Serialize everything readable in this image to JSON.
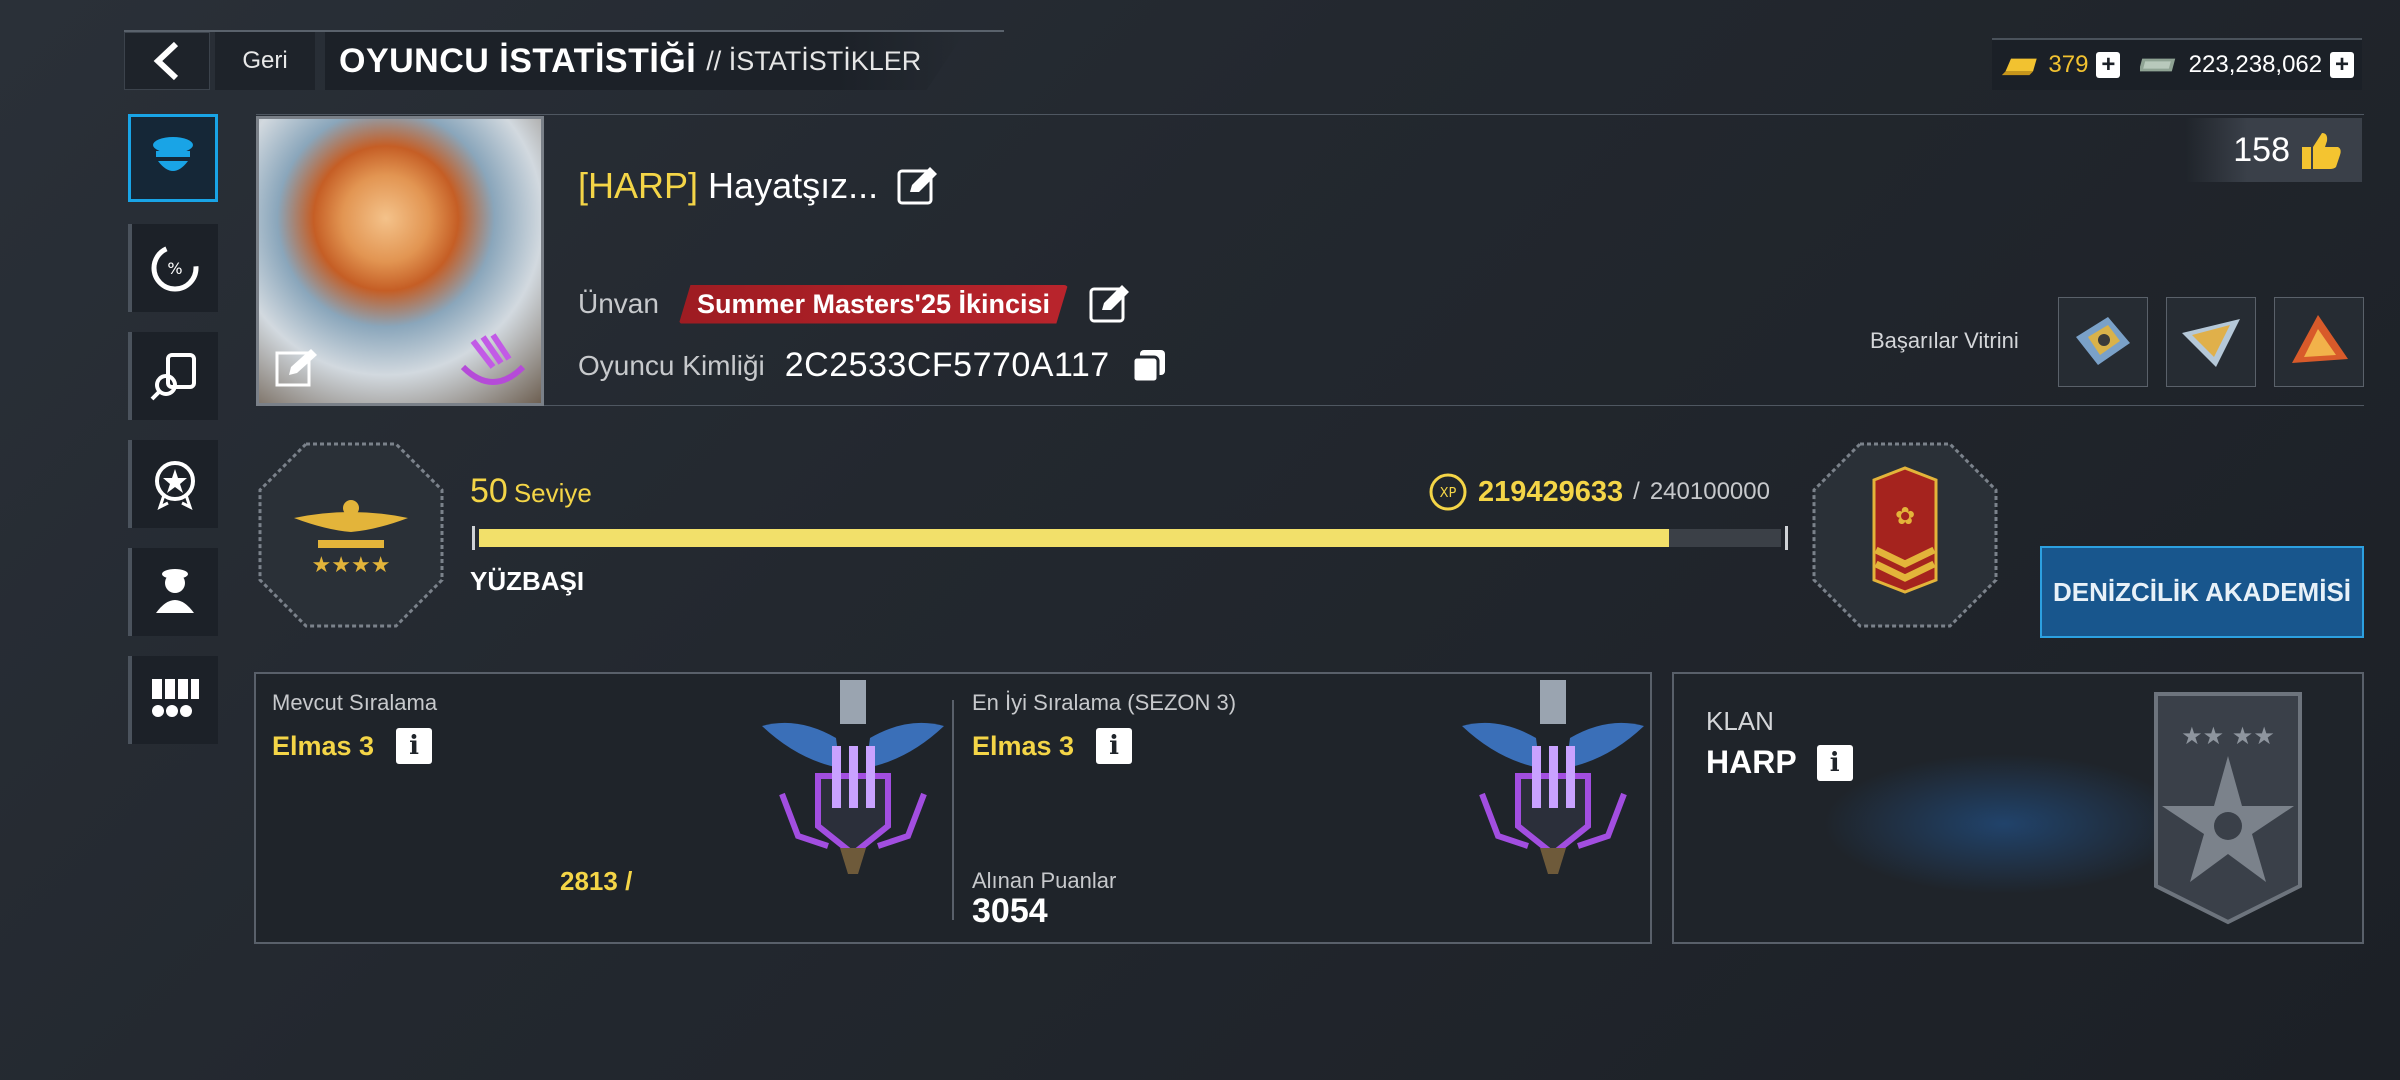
{
  "header": {
    "back_label": "Geri",
    "title": "OYUNCU İSTATİSTİĞİ",
    "subtitle": "// İSTATİSTİKLER"
  },
  "currency": {
    "gold": "379",
    "cash": "223,238,062",
    "gold_color": "#f2c230",
    "cash_color": "#9fb3a4"
  },
  "nav": {
    "items": [
      "profile-icon",
      "stats-icon",
      "search-report-icon",
      "medal-icon",
      "crew-icon",
      "ribbons-icon"
    ],
    "active": 0
  },
  "profile": {
    "clan_tag": "[HARP]",
    "name": "Hayatşız...",
    "title_label": "Ünvan",
    "title_value": "Summer Masters'25 İkincisi",
    "id_label": "Oyuncu Kimliği",
    "id_value": "2C2533CF5770A117",
    "likes": "158",
    "showcase_label": "Başarılar Vitrini"
  },
  "level": {
    "value": "50",
    "label": "Seviye",
    "rank": "YÜZBAŞI",
    "xp_current": "219429633",
    "xp_sep": "/",
    "xp_max": "240100000",
    "progress": 0.914,
    "xp_badge": "XP"
  },
  "academy_button": "DENİZCİLİK AKADEMİSİ",
  "ranking": {
    "current_label": "Mevcut Sıralama",
    "current_value": "Elmas 3",
    "current_points": "2813 /",
    "best_label": "En İyi Sıralama (SEZON 3)",
    "best_value": "Elmas 3",
    "points_label": "Alınan Puanlar",
    "points_value": "3054"
  },
  "clan": {
    "label": "KLAN",
    "name": "HARP"
  }
}
